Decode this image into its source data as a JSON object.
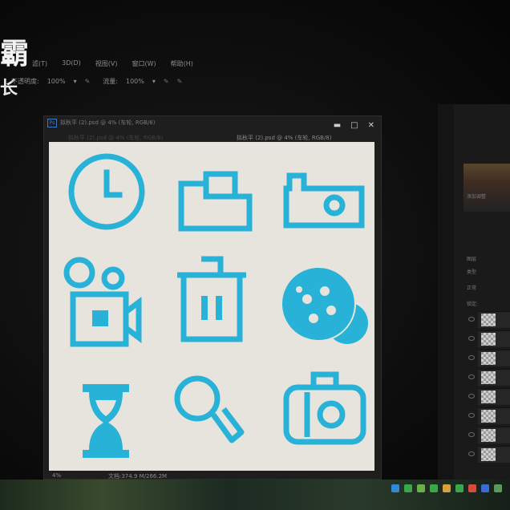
{
  "watermark": {
    "line1": "霸",
    "line2": "长"
  },
  "menu": {
    "items": [
      "滤(T)",
      "3D(D)",
      "视图(V)",
      "窗口(W)",
      "帮助(H)"
    ]
  },
  "options_bar": {
    "opacity_label": "不透明度:",
    "opacity_value": "100%",
    "flow_label": "流量:",
    "flow_value": "100%"
  },
  "document": {
    "title": "拟秋平 (2).psd @ 4% (车轮, RGB/8)",
    "tab_inactive": "拟秋平 (2).psd @ 4% (车轮, RGB/8)",
    "tab_active": "拟秋平 (2).psd @ 4% (车轮, RGB/8)",
    "zoom": "4%",
    "doc_size": "文档:374.9 M/266.2M",
    "icon_color": "#29b2d8",
    "canvas_color": "#e6e4dd"
  },
  "window_controls": {
    "minimize": "▬",
    "restore": "□",
    "close": "✕"
  },
  "panels": {
    "adjust_label": "添加调整",
    "layers_label": "图层",
    "kind_label": "类型",
    "blend_label": "正常",
    "lock_label": "锁定:",
    "layers": [
      "",
      "",
      "",
      "",
      "",
      "",
      "",
      ""
    ]
  },
  "icons": [
    "clock-icon",
    "folder-icon",
    "camera-icon",
    "video-camera-icon",
    "trash-icon",
    "film-reel-icon",
    "hourglass-icon",
    "magnifier-icon",
    "camera-2-icon"
  ]
}
